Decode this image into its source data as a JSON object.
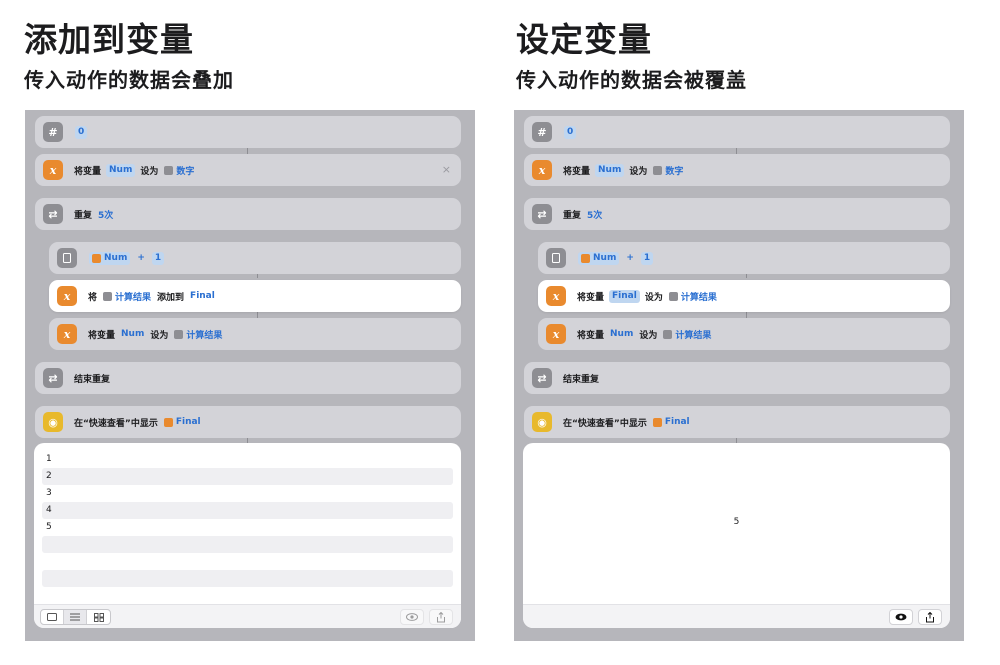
{
  "left": {
    "title": "添加到变量",
    "subtitle": "传入动作的数据会叠加",
    "number_value": "0",
    "set_var": {
      "prefix": "将变量",
      "var": "Num",
      "mid": "设为",
      "value": "数字"
    },
    "repeat": {
      "label": "重复",
      "count": "5次"
    },
    "calc": {
      "var": "Num",
      "op": "+",
      "value": "1"
    },
    "add_to_var": {
      "prefix": "将",
      "token": "计算结果",
      "mid": "添加到",
      "target": "Final"
    },
    "set_var2": {
      "prefix": "将变量",
      "var": "Num",
      "mid": "设为",
      "value": "计算结果"
    },
    "end_repeat": "结束重复",
    "quicklook": {
      "label": "在“快速查看”中显示",
      "var": "Final"
    },
    "result_rows": [
      "1",
      "2",
      "3",
      "4",
      "5",
      "",
      "",
      "",
      ""
    ]
  },
  "right": {
    "title": "设定变量",
    "subtitle": "传入动作的数据会被覆盖",
    "number_value": "0",
    "set_var": {
      "prefix": "将变量",
      "var": "Num",
      "mid": "设为",
      "value": "数字"
    },
    "repeat": {
      "label": "重复",
      "count": "5次"
    },
    "calc": {
      "var": "Num",
      "op": "+",
      "value": "1"
    },
    "set_final": {
      "prefix": "将变量",
      "var": "Final",
      "mid": "设为",
      "value": "计算结果"
    },
    "set_var2": {
      "prefix": "将变量",
      "var": "Num",
      "mid": "设为",
      "value": "计算结果"
    },
    "end_repeat": "结束重复",
    "quicklook": {
      "label": "在“快速查看”中显示",
      "var": "Final"
    },
    "result_value": "5"
  },
  "close_glyph": "×",
  "icons": {
    "number": "hash-icon",
    "variable": "variable-x-icon",
    "repeat": "repeat-icon",
    "calculate": "calculator-icon",
    "quicklook": "eye-icon",
    "share": "share-icon"
  },
  "colors": {
    "panel_bg": "#b6b6bb",
    "card_bg": "#d3d3d8",
    "selected_card": "#ffffff",
    "token_blue": "#2a6fd1",
    "variable_orange": "#e98a2e",
    "quicklook_yellow": "#e8b92c"
  }
}
